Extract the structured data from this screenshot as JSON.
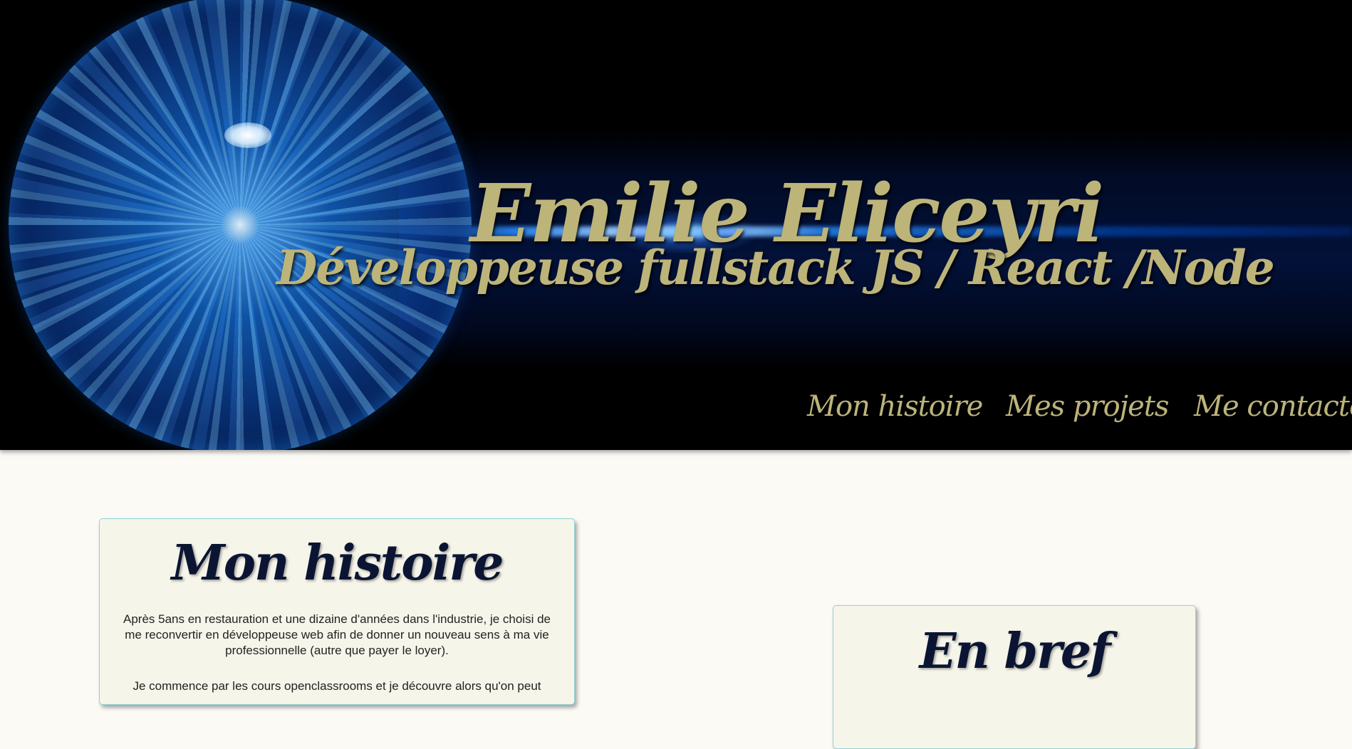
{
  "header": {
    "name": "Emilie Eliceyri",
    "role": "Développeuse fullstack JS / React /Node"
  },
  "nav": {
    "items": [
      {
        "label": "Mon histoire"
      },
      {
        "label": "Mes projets"
      },
      {
        "label": "Me contacter"
      }
    ]
  },
  "histoire": {
    "title": "Mon histoire",
    "paragraph1": "Après 5ans en restauration et une dizaine d'années dans l'industrie, je choisi de me reconvertir en développeuse web afin de donner un nouveau sens à ma vie professionnelle (autre que payer le loyer).",
    "paragraph2": "Je commence par les cours openclassrooms et je découvre alors qu'on peut"
  },
  "bref": {
    "title": "En bref"
  },
  "colors": {
    "header_bg": "#000000",
    "title_gold": "#bdb47a",
    "card_bg": "#f6f5ea",
    "card_border": "#8fd3d6",
    "heading_navy": "#0b1533",
    "page_bg": "#fbfaf5"
  }
}
